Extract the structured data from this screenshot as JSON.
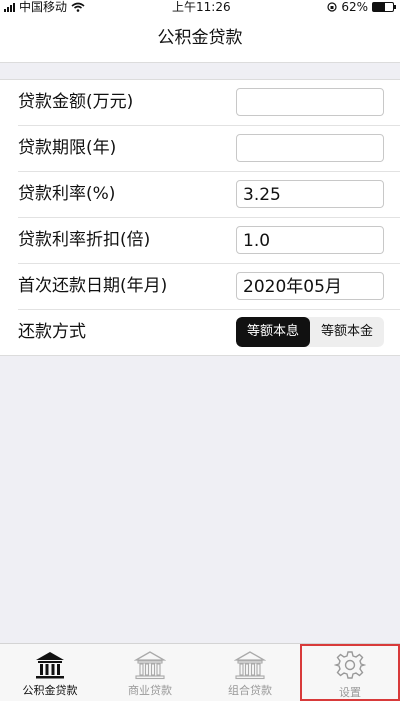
{
  "status_bar": {
    "carrier": "中国移动",
    "time": "上午11:26",
    "battery": "62%",
    "battery_level": 0.62
  },
  "header": {
    "title": "公积金贷款"
  },
  "form": {
    "loan_amount": {
      "label": "贷款金额(万元)",
      "value": ""
    },
    "loan_term": {
      "label": "贷款期限(年)",
      "value": ""
    },
    "interest_rate": {
      "label": "贷款利率(%)",
      "value": "3.25"
    },
    "rate_discount": {
      "label": "贷款利率折扣(倍)",
      "value": "1.0"
    },
    "first_payment_date": {
      "label": "首次还款日期(年月)",
      "value": "2020年05月"
    },
    "repayment_method": {
      "label": "还款方式",
      "options": [
        "等额本息",
        "等额本金"
      ],
      "selected": "等额本息"
    }
  },
  "tab_bar": {
    "tabs": [
      {
        "label": "公积金贷款",
        "icon": "bank-icon",
        "active": true
      },
      {
        "label": "商业贷款",
        "icon": "bank-icon",
        "active": false
      },
      {
        "label": "组合贷款",
        "icon": "bank-icon",
        "active": false
      },
      {
        "label": "设置",
        "icon": "gear-icon",
        "active": false
      }
    ],
    "highlight_color": "#d83a3a"
  }
}
